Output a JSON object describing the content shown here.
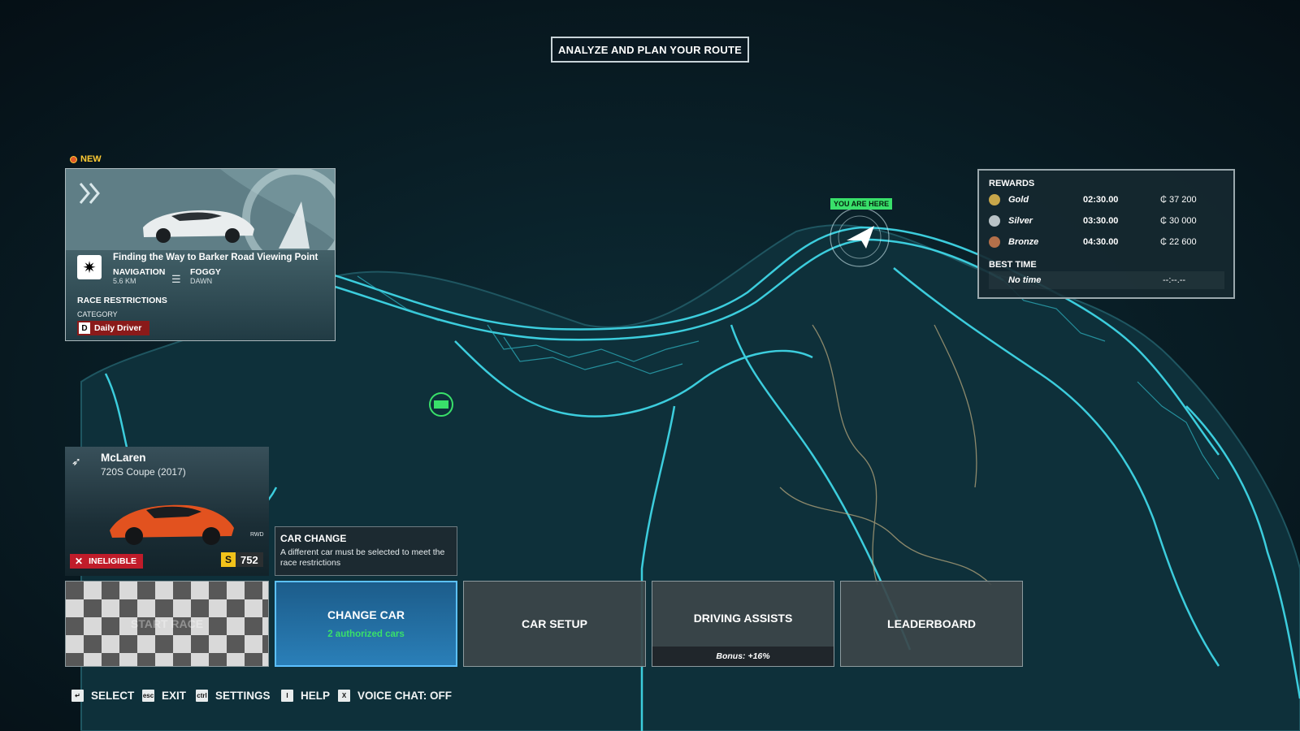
{
  "header": {
    "title": "ANALYZE AND PLAN YOUR ROUTE"
  },
  "map": {
    "you_are_here": "YOU ARE HERE"
  },
  "event": {
    "new_tag": "NEW",
    "title": "Finding the Way to Barker Road Viewing Point",
    "mode": "NAVIGATION",
    "distance": "5.6 KM",
    "weather": "FOGGY",
    "time_of_day": "DAWN",
    "restrictions_heading": "RACE RESTRICTIONS",
    "category_label": "CATEGORY",
    "category_letter": "D",
    "category_value": "Daily Driver"
  },
  "rewards": {
    "heading": "REWARDS",
    "tiers": [
      {
        "name": "Gold",
        "time": "02:30.00",
        "credits": "37 200",
        "color": "#c7a64a"
      },
      {
        "name": "Silver",
        "time": "03:30.00",
        "credits": "30 000",
        "color": "#b9c2c6"
      },
      {
        "name": "Bronze",
        "time": "04:30.00",
        "credits": "22 600",
        "color": "#b4704a"
      }
    ],
    "best_time_heading": "BEST TIME",
    "best_time_label": "No time",
    "best_time_value": "--:--.--"
  },
  "car": {
    "brand": "McLaren",
    "model": "720S Coupe (2017)",
    "status": "INELIGIBLE",
    "class_letter": "S",
    "rating": "752",
    "drive": "RWD"
  },
  "tooltip": {
    "title": "CAR CHANGE",
    "body": "A different car must be selected to meet the race restrictions"
  },
  "actions": {
    "start": "START RACE",
    "change_car": "CHANGE CAR",
    "change_car_sub": "2 authorized cars",
    "car_setup": "CAR SETUP",
    "driving_assists": "DRIVING ASSISTS",
    "assists_bonus": "Bonus: +16%",
    "leaderboard": "LEADERBOARD"
  },
  "hints": [
    {
      "key": "↵",
      "label": "SELECT"
    },
    {
      "key": "esc",
      "label": "EXIT"
    },
    {
      "key": "ctrl",
      "label": "SETTINGS"
    },
    {
      "key": "I",
      "label": "HELP"
    },
    {
      "key": "X",
      "label": "VOICE CHAT: OFF"
    }
  ],
  "colors": {
    "road": "#3fd6e6",
    "land": "#0b2a33",
    "accent_green": "#39e06a",
    "selected_blue": "#2a7fb8"
  }
}
